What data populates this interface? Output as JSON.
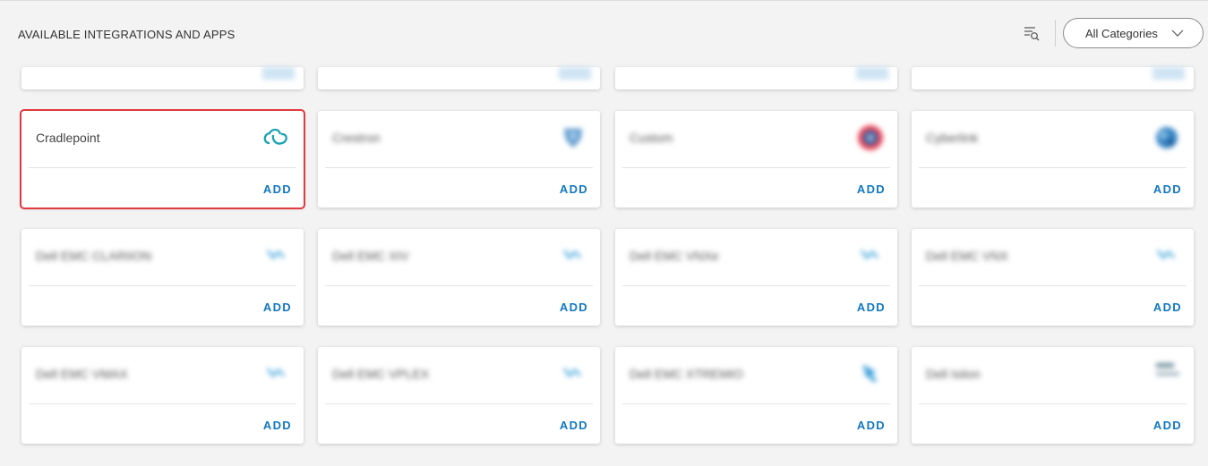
{
  "header": {
    "title": "AVAILABLE INTEGRATIONS AND APPS",
    "category_select": "All Categories",
    "filter_icon": "search-filter-icon"
  },
  "colors": {
    "accent": "#1278c1",
    "highlight": "#e0393e",
    "cradlepoint_logo": "#1aa3b2"
  },
  "cards": [
    {
      "name": "Cradlepoint",
      "action": "ADD",
      "icon": "cradlepoint-logo-icon"
    },
    {
      "name": "Crestron",
      "action": "ADD",
      "icon": "shield-logo-icon"
    },
    {
      "name": "Custom",
      "action": "ADD",
      "icon": "round-red-logo-icon"
    },
    {
      "name": "Cyberlink",
      "action": "ADD",
      "icon": "globe-logo-icon"
    },
    {
      "name": "Dell EMC CLARIION",
      "action": "ADD",
      "icon": "dell-emc-logo-icon"
    },
    {
      "name": "Dell EMC XIV",
      "action": "ADD",
      "icon": "dell-emc-logo-icon"
    },
    {
      "name": "Dell EMC VNXe",
      "action": "ADD",
      "icon": "dell-emc-logo-icon"
    },
    {
      "name": "Dell EMC VNX",
      "action": "ADD",
      "icon": "dell-emc-logo-icon"
    },
    {
      "name": "Dell EMC VMAX",
      "action": "ADD",
      "icon": "dell-emc-logo-icon"
    },
    {
      "name": "Dell EMC VPLEX",
      "action": "ADD",
      "icon": "dell-emc-logo-icon"
    },
    {
      "name": "Dell EMC XTREMIO",
      "action": "ADD",
      "icon": "dell-emc-logo-icon"
    },
    {
      "name": "Dell Isilon",
      "action": "ADD",
      "icon": "dell-text-logo-icon"
    }
  ]
}
